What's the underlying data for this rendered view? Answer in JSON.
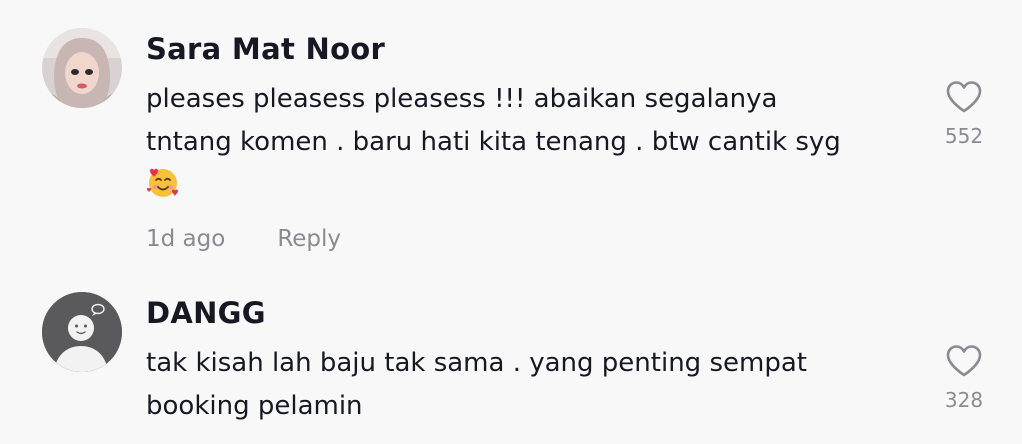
{
  "comments": [
    {
      "username": "Sara Mat Noor",
      "line1": "pleases pleasess pleasess !!! abaikan segalanya",
      "line2": "tntang komen . baru hati kita tenang . btw cantik syg",
      "emoji_icon": "smiling-face-with-hearts-icon",
      "time": "1d ago",
      "reply_label": "Reply",
      "likes": "552"
    },
    {
      "username": "DANGG",
      "line1": "tak kisah lah baju tak sama . yang penting sempat",
      "line2": "booking pelamin",
      "likes": "328"
    }
  ],
  "colors": {
    "background": "#f8f8f8",
    "primary_text": "#161823",
    "secondary_text": "#8a8b91",
    "icon": "#8a8b91"
  }
}
